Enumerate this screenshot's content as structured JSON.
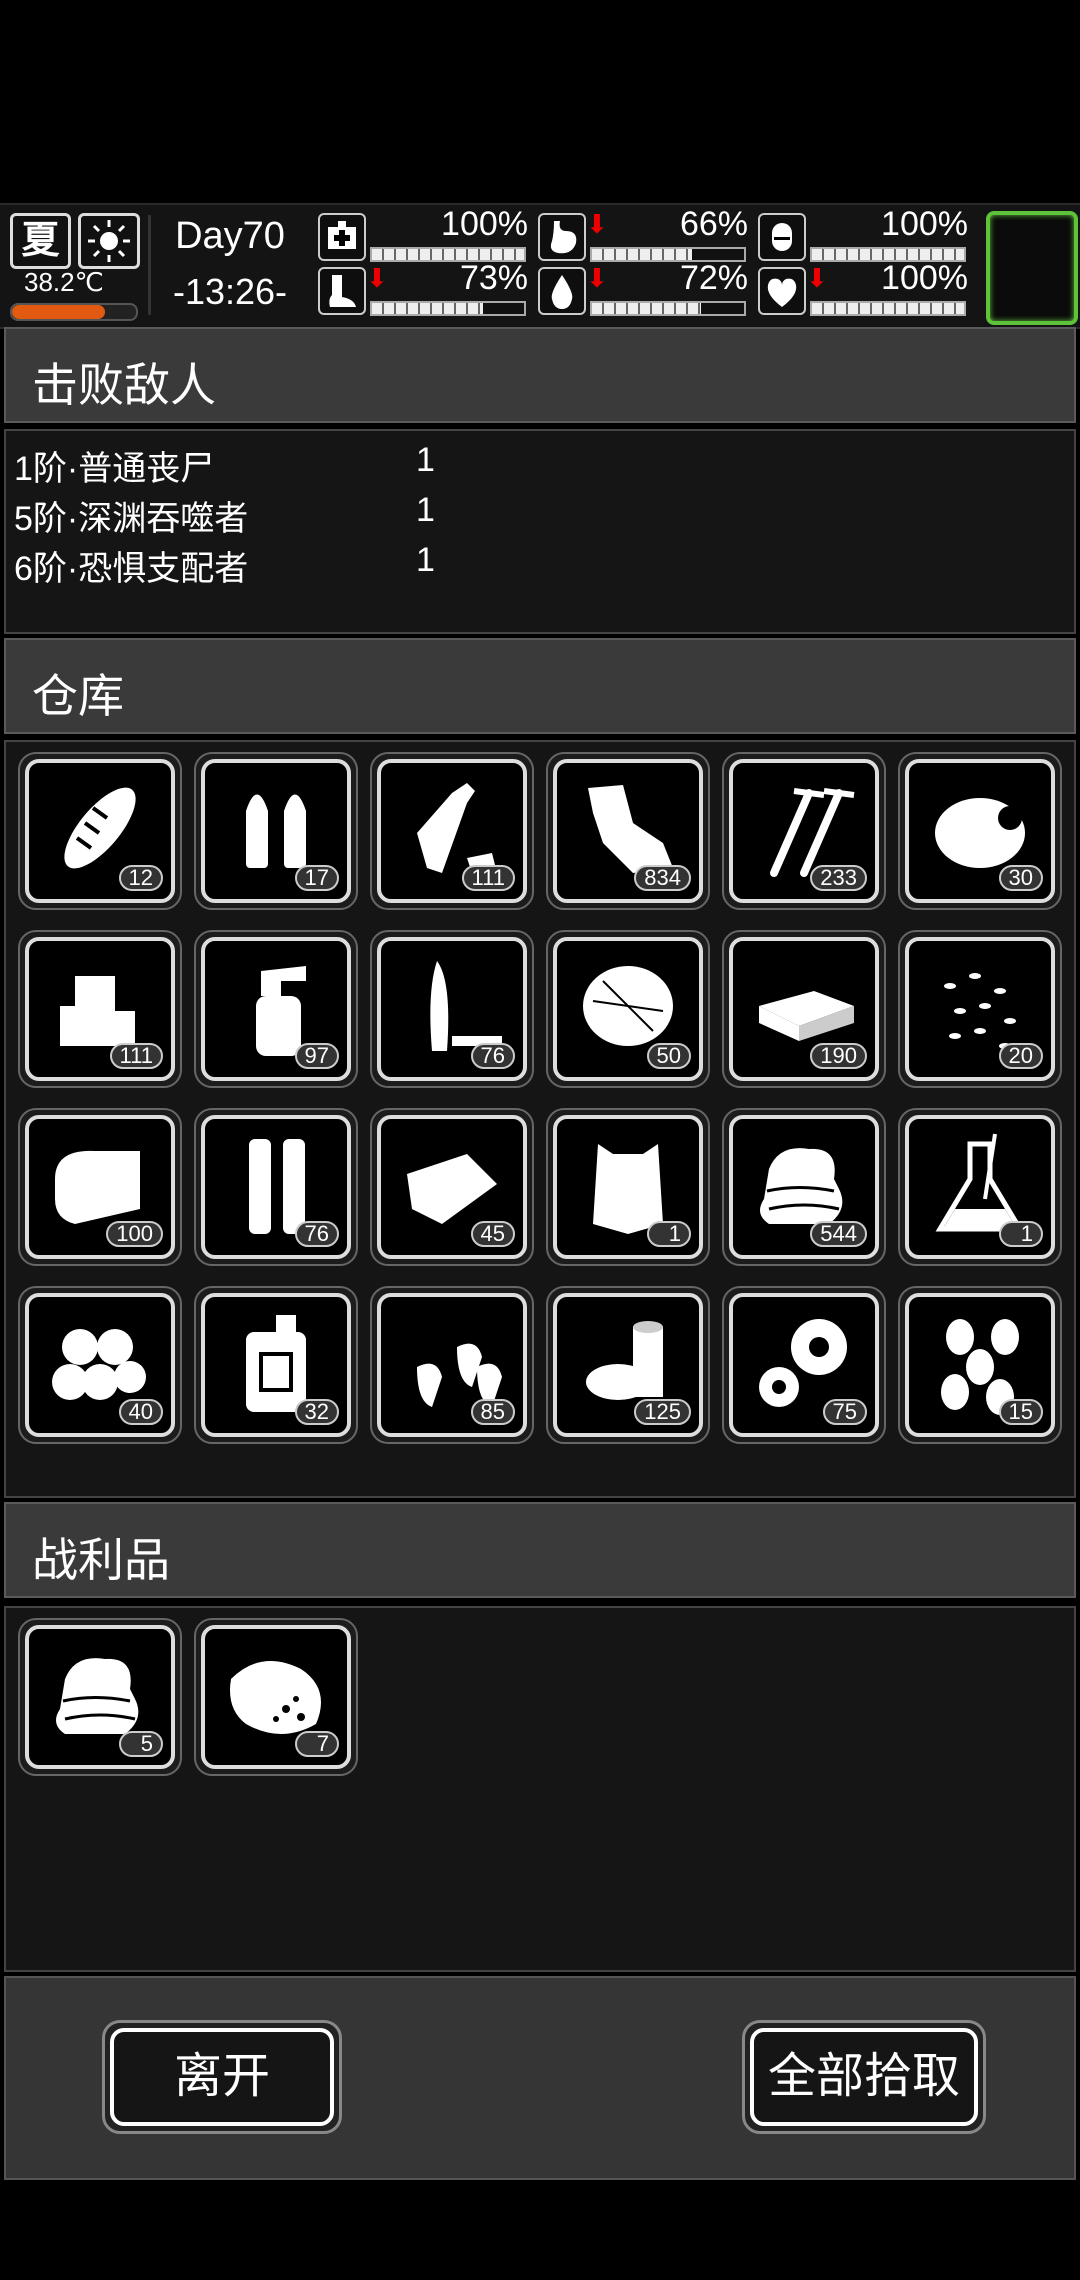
{
  "status": {
    "season": "夏",
    "weather_icon": "sun-icon",
    "temperature": "38.2℃",
    "temperature_level_pct": 75,
    "day": "Day70",
    "time": "-13:26-",
    "stats": [
      {
        "name": "health",
        "icon": "medkit-icon",
        "value": "100%",
        "pct": 100,
        "down": false
      },
      {
        "name": "hunger",
        "icon": "stomach-icon",
        "value": "66%",
        "pct": 66,
        "down": true
      },
      {
        "name": "medicine",
        "icon": "pill-icon",
        "value": "100%",
        "pct": 100,
        "down": false
      },
      {
        "name": "stamina",
        "icon": "foot-icon",
        "value": "73%",
        "pct": 73,
        "down": true
      },
      {
        "name": "thirst",
        "icon": "water-drop-icon",
        "value": "72%",
        "pct": 72,
        "down": true
      },
      {
        "name": "mood",
        "icon": "heart-icon",
        "value": "100%",
        "pct": 100,
        "down": true
      }
    ],
    "accent": "#5ec23a",
    "arrow_color": "#e00000"
  },
  "defeated": {
    "title": "击败敌人",
    "enemies": [
      {
        "name": "1阶·普通丧尸",
        "count": "1"
      },
      {
        "name": "5阶·深渊吞噬者",
        "count": "1"
      },
      {
        "name": "6阶·恐惧支配者",
        "count": "1"
      }
    ]
  },
  "warehouse": {
    "title": "仓库",
    "items": [
      {
        "icon": "bread-icon",
        "count": "12"
      },
      {
        "icon": "bullets-icon",
        "count": "17"
      },
      {
        "icon": "plastic-bottle-icon",
        "count": "111"
      },
      {
        "icon": "scrap-cloth-icon",
        "count": "834"
      },
      {
        "icon": "screws-icon",
        "count": "233"
      },
      {
        "icon": "meat-icon",
        "count": "30"
      },
      {
        "icon": "ice-icon",
        "count": "111"
      },
      {
        "icon": "spray-bottle-icon",
        "count": "97"
      },
      {
        "icon": "blade-icon",
        "count": "76"
      },
      {
        "icon": "fiber-icon",
        "count": "50"
      },
      {
        "icon": "cash-icon",
        "count": "190"
      },
      {
        "icon": "seeds-icon",
        "count": "20"
      },
      {
        "icon": "towel-icon",
        "count": "100"
      },
      {
        "icon": "tubes-icon",
        "count": "76"
      },
      {
        "icon": "cloth-icon",
        "count": "45"
      },
      {
        "icon": "fur-icon",
        "count": "1"
      },
      {
        "icon": "fabric-stack-icon",
        "count": "544"
      },
      {
        "icon": "flask-icon",
        "count": "1"
      },
      {
        "icon": "cotton-icon",
        "count": "40"
      },
      {
        "icon": "canister-icon",
        "count": "32"
      },
      {
        "icon": "pellets-icon",
        "count": "85"
      },
      {
        "icon": "pipes-icon",
        "count": "125"
      },
      {
        "icon": "gears-icon",
        "count": "75"
      },
      {
        "icon": "beans-icon",
        "count": "15"
      }
    ]
  },
  "loot": {
    "title": "战利品",
    "items": [
      {
        "icon": "fabric-stack-icon",
        "count": "5"
      },
      {
        "icon": "raw-meat-icon",
        "count": "7"
      }
    ]
  },
  "buttons": {
    "leave": "离开",
    "pickup_all": "全部拾取"
  }
}
